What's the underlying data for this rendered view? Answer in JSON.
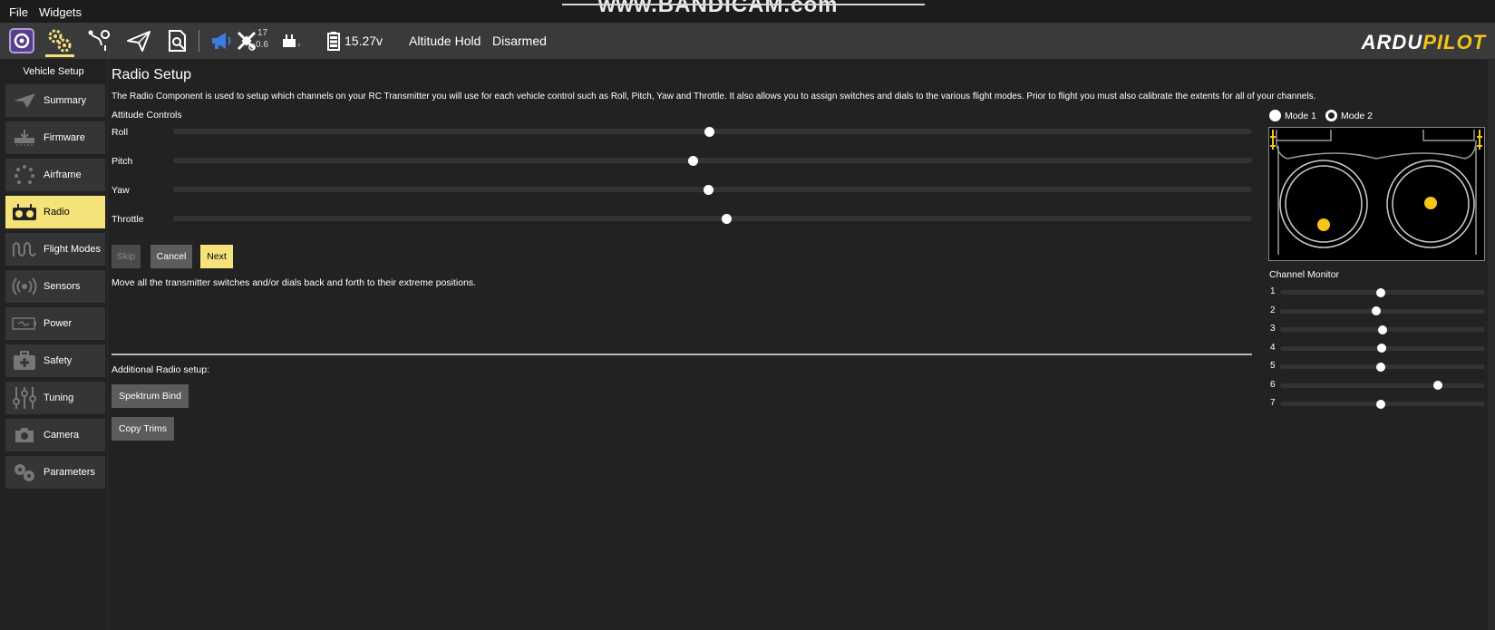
{
  "menubar": {
    "file": "File",
    "widgets": "Widgets"
  },
  "watermark": "www.BANDICAM.com",
  "toolbar": {
    "gps_count": "17",
    "gps_hdop": "0.6",
    "battery": "15.27v",
    "flight_mode": "Altitude Hold",
    "arm_state": "Disarmed",
    "logo_left": "ARDU",
    "logo_right": "PILOT",
    "icons": [
      "qgc-logo-icon",
      "vehicle-setup-gears-icon",
      "plan-view-icon",
      "fly-view-icon",
      "analyze-icon",
      "messages-megaphone-icon",
      "gps-satellite-icon",
      "rc-rssi-icon",
      "battery-icon"
    ]
  },
  "sidebar": {
    "header": "Vehicle Setup",
    "items": [
      {
        "label": "Summary",
        "icon": "paper-plane-icon"
      },
      {
        "label": "Firmware",
        "icon": "firmware-download-icon"
      },
      {
        "label": "Airframe",
        "icon": "airframe-dots-icon"
      },
      {
        "label": "Radio",
        "icon": "radio-transmitter-icon"
      },
      {
        "label": "Flight Modes",
        "icon": "flight-modes-wave-icon"
      },
      {
        "label": "Sensors",
        "icon": "sensors-signal-icon"
      },
      {
        "label": "Power",
        "icon": "power-battery-icon"
      },
      {
        "label": "Safety",
        "icon": "safety-kit-icon"
      },
      {
        "label": "Tuning",
        "icon": "tuning-sliders-icon"
      },
      {
        "label": "Camera",
        "icon": "camera-icon"
      },
      {
        "label": "Parameters",
        "icon": "parameters-gears-icon"
      }
    ],
    "active": "Radio"
  },
  "main": {
    "title": "Radio Setup",
    "description": "The Radio Component is used to setup which channels on your RC Transmitter you will use for each vehicle control such as Roll, Pitch, Yaw and Throttle. It also allows you to assign switches and dials to the various flight modes. Prior to flight you must also calibrate the extents for all of your channels.",
    "attitude_header": "Attitude Controls",
    "controls": [
      {
        "label": "Roll",
        "value": 0.497
      },
      {
        "label": "Pitch",
        "value": 0.482
      },
      {
        "label": "Yaw",
        "value": 0.496
      },
      {
        "label": "Throttle",
        "value": 0.513
      }
    ],
    "buttons": {
      "skip": "Skip",
      "cancel": "Cancel",
      "next": "Next"
    },
    "instruction": "Move all the transmitter switches and/or dials back and forth to their extreme positions.",
    "additional_header": "Additional Radio setup:",
    "spektrum_bind": "Spektrum Bind",
    "copy_trims": "Copy Trims"
  },
  "right": {
    "mode1": "Mode 1",
    "mode2": "Mode 2",
    "selected_mode": "Mode 2",
    "channel_monitor_title": "Channel Monitor",
    "channels": [
      {
        "num": "1",
        "value": 0.49
      },
      {
        "num": "2",
        "value": 0.468
      },
      {
        "num": "3",
        "value": 0.5
      },
      {
        "num": "4",
        "value": 0.495
      },
      {
        "num": "5",
        "value": 0.49
      },
      {
        "num": "6",
        "value": 0.77
      },
      {
        "num": "7",
        "value": 0.49
      }
    ]
  },
  "colors": {
    "accent": "#f5e37a",
    "stick_dot": "#f5c518",
    "background": "#222222",
    "toolbar": "#3a3a3a"
  }
}
